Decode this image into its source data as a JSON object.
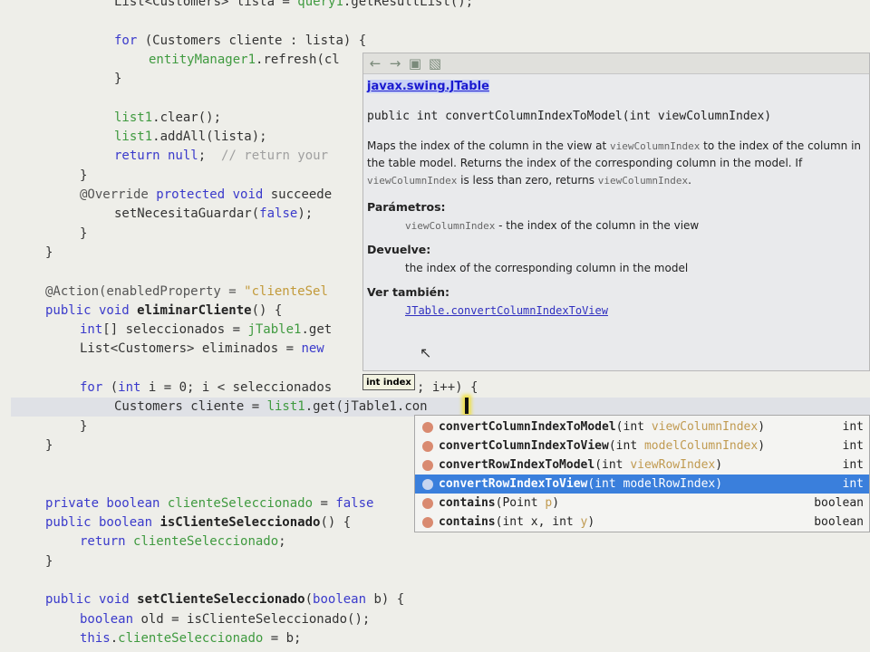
{
  "code": {
    "current_line": 21,
    "lines": [
      {
        "indent": 3,
        "tokens": [
          [
            "List<Customers> lista = ",
            ""
          ],
          [
            "query1",
            ".fld"
          ],
          [
            ".getResultList();",
            ""
          ]
        ]
      },
      {
        "indent": 0,
        "tokens": []
      },
      {
        "indent": 3,
        "tokens": [
          [
            "for",
            "kw"
          ],
          [
            " (Customers cliente : lista) {",
            ""
          ]
        ]
      },
      {
        "indent": 4,
        "tokens": [
          [
            "entityManager1",
            "fld"
          ],
          [
            ".refresh(cl",
            ""
          ]
        ]
      },
      {
        "indent": 3,
        "tokens": [
          [
            "}",
            ""
          ]
        ]
      },
      {
        "indent": 0,
        "tokens": []
      },
      {
        "indent": 3,
        "tokens": [
          [
            "list1",
            "fld"
          ],
          [
            ".clear();",
            ""
          ]
        ]
      },
      {
        "indent": 3,
        "tokens": [
          [
            "list1",
            "fld"
          ],
          [
            ".addAll(lista);",
            ""
          ]
        ]
      },
      {
        "indent": 3,
        "tokens": [
          [
            "return null",
            "kw"
          ],
          [
            ";  ",
            ""
          ],
          [
            "// return your",
            "",
            " cmt"
          ]
        ]
      },
      {
        "indent": 2,
        "tokens": [
          [
            "}",
            ""
          ]
        ]
      },
      {
        "indent": 2,
        "tokens": [
          [
            "@Override ",
            "ann"
          ],
          [
            "protected void ",
            "kw"
          ],
          [
            "succeede",
            ""
          ]
        ]
      },
      {
        "indent": 3,
        "tokens": [
          [
            "setNecesitaGuardar(",
            ""
          ],
          [
            "false",
            "kw"
          ],
          [
            ");",
            ""
          ]
        ]
      },
      {
        "indent": 2,
        "tokens": [
          [
            "}",
            ""
          ]
        ]
      },
      {
        "indent": 1,
        "tokens": [
          [
            "}",
            ""
          ]
        ]
      },
      {
        "indent": 0,
        "tokens": []
      },
      {
        "indent": 1,
        "tokens": [
          [
            "@Action(enabledProperty = ",
            "ann"
          ],
          [
            "\"clienteSel",
            "str"
          ]
        ]
      },
      {
        "indent": 1,
        "tokens": [
          [
            "public void ",
            "kw"
          ],
          [
            "eliminarCliente",
            "meth"
          ],
          [
            "() {",
            ""
          ]
        ]
      },
      {
        "indent": 2,
        "tokens": [
          [
            "int",
            "kw"
          ],
          [
            "[] seleccionados = ",
            ""
          ],
          [
            "jTable1",
            "fld"
          ],
          [
            ".get",
            ""
          ]
        ]
      },
      {
        "indent": 2,
        "tokens": [
          [
            "List<Customers> eliminados = ",
            ""
          ],
          [
            "new",
            "kw"
          ]
        ]
      },
      {
        "indent": 0,
        "tokens": []
      },
      {
        "indent": 2,
        "tokens": [
          [
            "for",
            "kw"
          ],
          [
            " (",
            ""
          ],
          [
            "int",
            "kw"
          ],
          [
            " i = 0; i < seleccionados",
            ""
          ]
        ]
      },
      {
        "indent": 3,
        "tokens": [
          [
            "Customers cliente = ",
            ""
          ],
          [
            "list1",
            "fld"
          ],
          [
            ".get(",
            ""
          ],
          [
            "jTable1.con",
            ""
          ]
        ]
      },
      {
        "indent": 2,
        "tokens": [
          [
            "}",
            ""
          ]
        ]
      },
      {
        "indent": 1,
        "tokens": [
          [
            "}",
            ""
          ]
        ]
      },
      {
        "indent": 0,
        "tokens": []
      },
      {
        "indent": 0,
        "tokens": []
      },
      {
        "indent": 1,
        "tokens": [
          [
            "private boolean ",
            "kw"
          ],
          [
            "clienteSeleccionado",
            "fld"
          ],
          [
            " = ",
            ""
          ],
          [
            "false",
            "kw"
          ]
        ]
      },
      {
        "indent": 1,
        "tokens": [
          [
            "public boolean ",
            "kw"
          ],
          [
            "isClienteSeleccionado",
            "meth"
          ],
          [
            "() {",
            ""
          ]
        ]
      },
      {
        "indent": 2,
        "tokens": [
          [
            "return ",
            "kw"
          ],
          [
            "clienteSeleccionado",
            "fld"
          ],
          [
            ";",
            ""
          ]
        ]
      },
      {
        "indent": 1,
        "tokens": [
          [
            "}",
            ""
          ]
        ]
      },
      {
        "indent": 0,
        "tokens": []
      },
      {
        "indent": 1,
        "tokens": [
          [
            "public void ",
            "kw"
          ],
          [
            "setClienteSeleccionado",
            "meth"
          ],
          [
            "(",
            ""
          ],
          [
            "boolean",
            "kw"
          ],
          [
            " b) {",
            ""
          ]
        ]
      },
      {
        "indent": 2,
        "tokens": [
          [
            "boolean",
            "kw"
          ],
          [
            " old = isClienteSeleccionado();",
            ""
          ]
        ]
      },
      {
        "indent": 2,
        "tokens": [
          [
            "this",
            "kw"
          ],
          [
            ".",
            ""
          ],
          [
            "clienteSeleccionado",
            "fld"
          ],
          [
            " = b;",
            ""
          ]
        ]
      }
    ],
    "trailing_after_for": "; i++) {"
  },
  "doc_popup": {
    "toolbar": [
      "back-icon",
      "forward-icon",
      "open-in-browser-icon",
      "source-icon"
    ],
    "class_link": "javax.swing.JTable",
    "signature": "public int convertColumnIndexToModel(int viewColumnIndex)",
    "desc_parts": [
      "Maps the index of the column in the view at ",
      "viewColumnIndex",
      " to the index of the column in the table model. Returns the index of the corresponding column in the model. If ",
      "viewColumnIndex",
      " is less than zero, returns ",
      "viewColumnIndex",
      "."
    ],
    "params_heading": "Parámetros:",
    "param_name": "viewColumnIndex",
    "param_desc": " - the index of the column in the view",
    "returns_heading": "Devuelve:",
    "returns_desc": "the index of the corresponding column in the model",
    "see_heading": "Ver también:",
    "see_link": "JTable.convertColumnIndexToView"
  },
  "param_tooltip": "int index",
  "completion": {
    "selected_index": 3,
    "items": [
      {
        "name": "convertColumnIndexToModel",
        "open": "(int ",
        "param": "viewColumnIndex",
        "close": ")",
        "ret": "int"
      },
      {
        "name": "convertColumnIndexToView",
        "open": "(int ",
        "param": "modelColumnIndex",
        "close": ")",
        "ret": "int"
      },
      {
        "name": "convertRowIndexToModel",
        "open": "(int ",
        "param": "viewRowIndex",
        "close": ")",
        "ret": "int"
      },
      {
        "name": "convertRowIndexToView",
        "open": "(int ",
        "param": "modelRowIndex",
        "close": ")",
        "ret": "int"
      },
      {
        "name": "contains",
        "open": "(Point ",
        "param": "p",
        "close": ")",
        "ret": "boolean"
      },
      {
        "name": "contains",
        "open": "(int x, int ",
        "param": "y",
        "close": ")",
        "ret": "boolean"
      }
    ]
  },
  "colors": {
    "keyword": "#3a3acb",
    "field": "#3f9a3f",
    "selection": "#3a7fdc"
  }
}
